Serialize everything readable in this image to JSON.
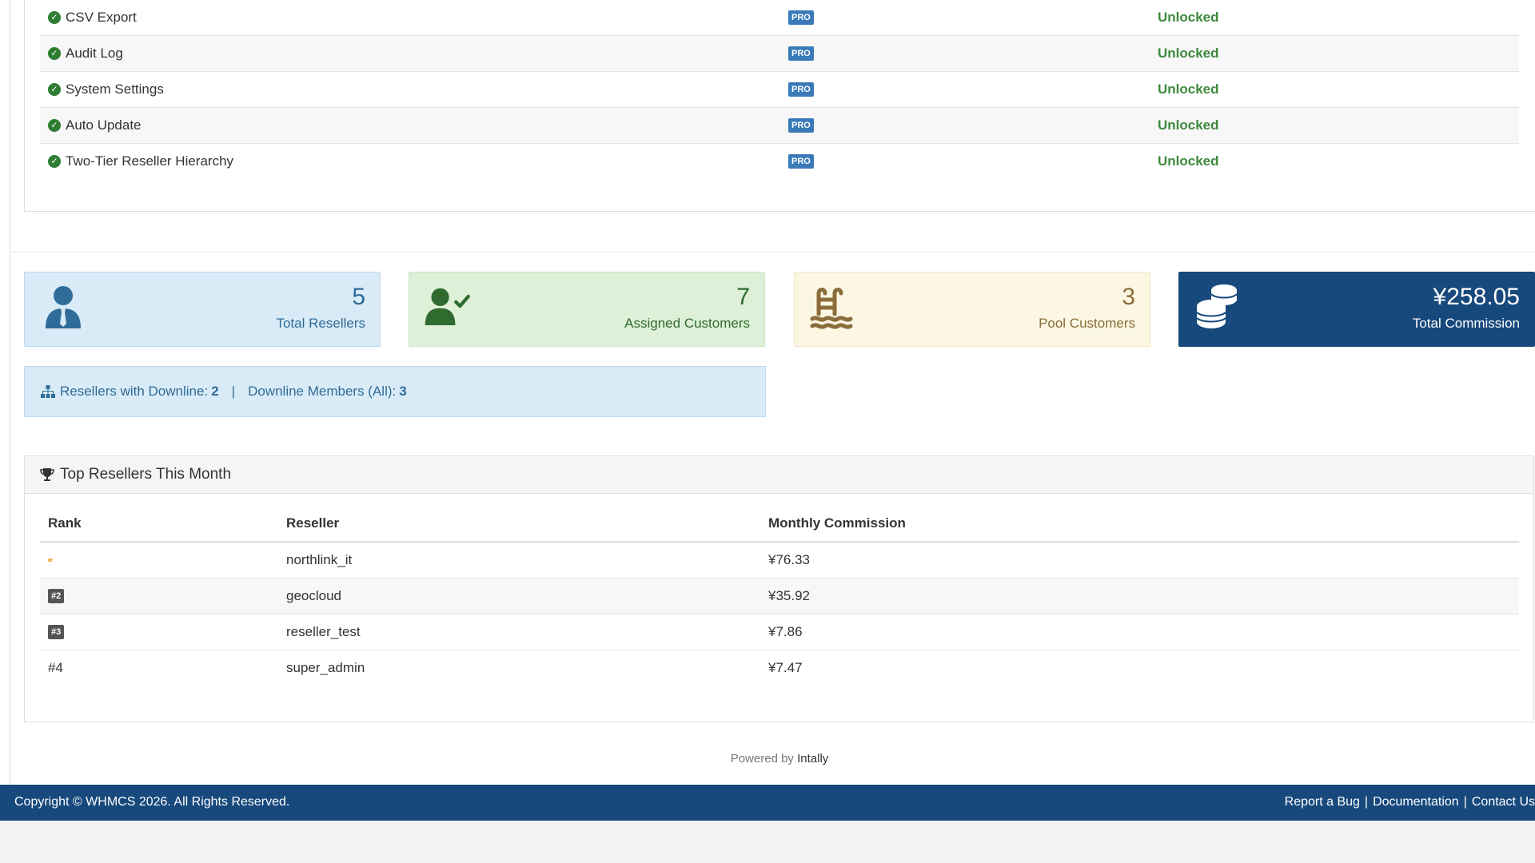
{
  "features": [
    {
      "name": "CSV Export",
      "badge": "PRO",
      "status": "Unlocked"
    },
    {
      "name": "Audit Log",
      "badge": "PRO",
      "status": "Unlocked"
    },
    {
      "name": "System Settings",
      "badge": "PRO",
      "status": "Unlocked"
    },
    {
      "name": "Auto Update",
      "badge": "PRO",
      "status": "Unlocked"
    },
    {
      "name": "Two-Tier Reseller Hierarchy",
      "badge": "PRO",
      "status": "Unlocked"
    }
  ],
  "stats": {
    "total_resellers": {
      "value": "5",
      "label": "Total Resellers",
      "icon": "user-tie-icon"
    },
    "assigned_customers": {
      "value": "7",
      "label": "Assigned Customers",
      "icon": "user-check-icon"
    },
    "pool_customers": {
      "value": "3",
      "label": "Pool Customers",
      "icon": "swimming-pool-icon"
    },
    "total_commission": {
      "value": "¥258.05",
      "label": "Total Commission",
      "icon": "coins-icon"
    }
  },
  "downline": {
    "resellers_label": "Resellers with Downline:",
    "resellers_value": "2",
    "separator": "|",
    "members_label": "Downline Members (All):",
    "members_value": "3"
  },
  "top_resellers": {
    "title": "Top Resellers This Month",
    "columns": [
      "Rank",
      "Reseller",
      "Monthly Commission"
    ],
    "rows": [
      {
        "rank": "#1",
        "reseller": "northlink_it",
        "commission": "¥76.33"
      },
      {
        "rank": "#2",
        "reseller": "geocloud",
        "commission": "¥35.92"
      },
      {
        "rank": "#3",
        "reseller": "reseller_test",
        "commission": "¥7.86"
      },
      {
        "rank": "#4",
        "reseller": "super_admin",
        "commission": "¥7.47"
      }
    ]
  },
  "powered": {
    "prefix": "Powered by",
    "brand": "Intally"
  },
  "footer": {
    "copyright": "Copyright © WHMCS 2026. All Rights Reserved.",
    "links": [
      "Report a Bug",
      "Documentation",
      "Contact Us"
    ]
  },
  "colors": {
    "primary": "#17497c",
    "success": "#3c8a3c",
    "pro": "#3a7ab8",
    "gold": "#f0ad4e"
  }
}
